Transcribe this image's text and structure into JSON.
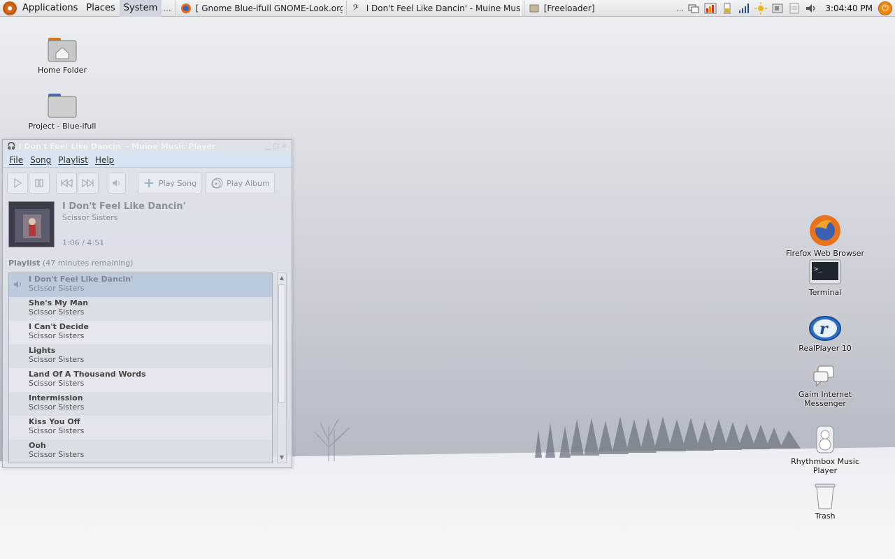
{
  "panel": {
    "menus": [
      "Applications",
      "Places",
      "System"
    ],
    "tasks": [
      {
        "label": "[ Gnome Blue-ifull GNOME-Look.org ...",
        "icon": "firefox-icon"
      },
      {
        "label": "I Don't Feel Like Dancin' - Muine Mus...",
        "icon": "muine-icon"
      },
      {
        "label": "[Freeloader]",
        "icon": "freeloader-icon"
      }
    ],
    "overflow": "...",
    "clock": "3:04:40 PM"
  },
  "desktop_icons": {
    "left": [
      "Home Folder",
      "Project - Blue-ifull"
    ],
    "right": [
      "Firefox Web Browser",
      "Terminal",
      "RealPlayer 10",
      "Gaim Internet Messenger",
      "Rhythmbox Music Player",
      "Trash"
    ]
  },
  "window": {
    "title": "I Don't Feel Like Dancin' - Muine Music Player",
    "menu": [
      "File",
      "Song",
      "Playlist",
      "Help"
    ],
    "toolbar": {
      "play_song": "Play Song",
      "play_album": "Play Album"
    },
    "now_playing": {
      "title": "I Don't Feel Like Dancin'",
      "artist": "Scissor Sisters",
      "time": "1:06 / 4:51"
    },
    "playlist_label": "Playlist",
    "playlist_remaining": "(47 minutes remaining)",
    "playlist": [
      {
        "title": "I Don't Feel Like Dancin'",
        "artist": "Scissor Sisters"
      },
      {
        "title": "She's My Man",
        "artist": "Scissor Sisters"
      },
      {
        "title": "I Can't Decide",
        "artist": "Scissor Sisters"
      },
      {
        "title": "Lights",
        "artist": "Scissor Sisters"
      },
      {
        "title": "Land Of A Thousand Words",
        "artist": "Scissor Sisters"
      },
      {
        "title": "Intermission",
        "artist": "Scissor Sisters"
      },
      {
        "title": "Kiss You Off",
        "artist": "Scissor Sisters"
      },
      {
        "title": "Ooh",
        "artist": "Scissor Sisters"
      }
    ]
  },
  "colors": {
    "accent": "#f08a16",
    "selection": "#b2c3d8"
  }
}
